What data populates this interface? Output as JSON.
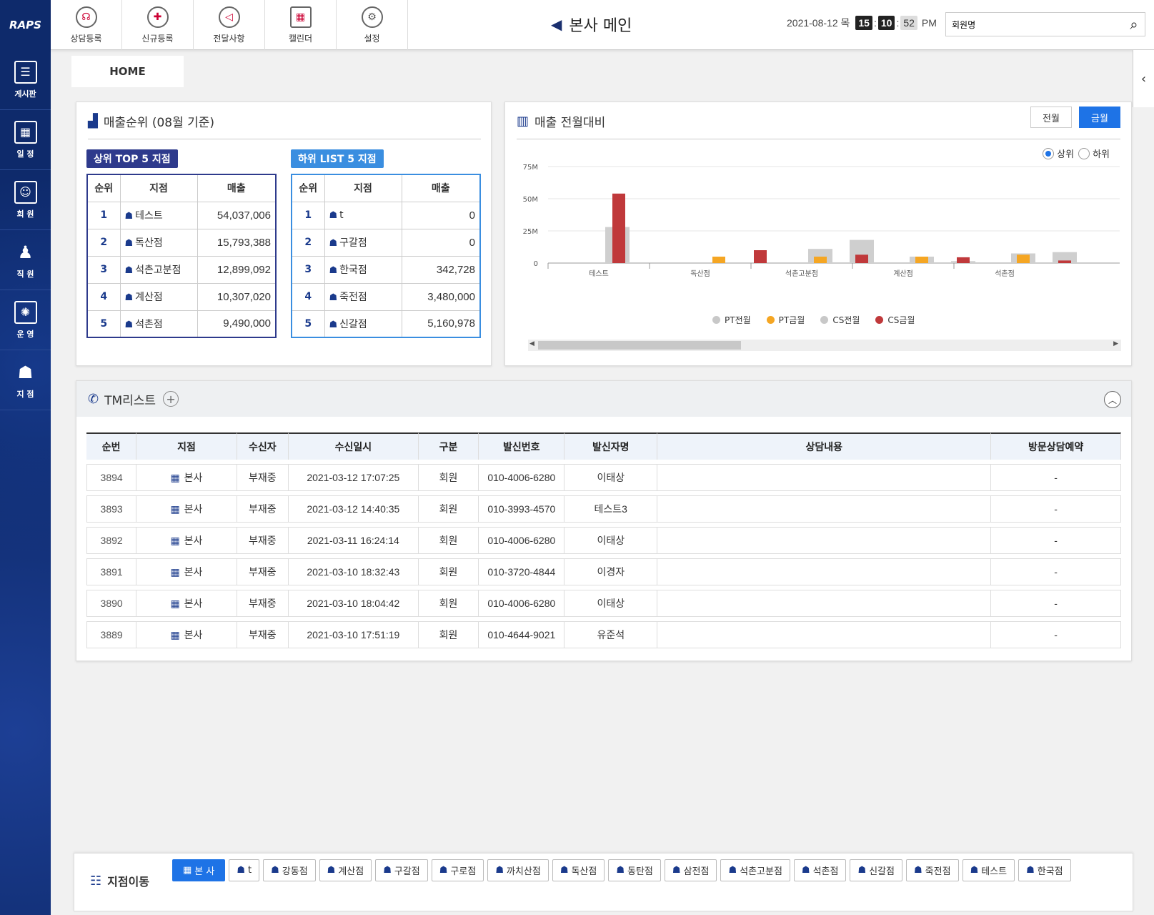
{
  "logo": "RAPS",
  "sidebar": [
    {
      "label": "게시판",
      "icon": "board-icon"
    },
    {
      "label": "일 정",
      "icon": "calendar-icon"
    },
    {
      "label": "회 원",
      "icon": "member-icon"
    },
    {
      "label": "직 원",
      "icon": "staff-icon"
    },
    {
      "label": "운 영",
      "icon": "operation-icon"
    },
    {
      "label": "지 점",
      "icon": "branch-icon"
    }
  ],
  "topmenu": [
    {
      "label": "상담등록",
      "icon": "consult-icon"
    },
    {
      "label": "신규등록",
      "icon": "new-user-icon"
    },
    {
      "label": "전달사항",
      "icon": "megaphone-icon"
    },
    {
      "label": "캘린더",
      "icon": "calendar-icon"
    },
    {
      "label": "설정",
      "icon": "gear-icon"
    }
  ],
  "header": {
    "title": "본사 메인",
    "date": "2021-08-12 목",
    "hour": "15",
    "minute": "10",
    "second": "52",
    "ampm": "PM",
    "search_value": "회원명"
  },
  "home_tab": "HOME",
  "ranking": {
    "title": "매출순위",
    "subtitle": "(08월 기준)",
    "top_label": "상위 TOP 5 지점",
    "low_label": "하위 LIST 5 지점",
    "columns": [
      "순위",
      "지점",
      "매출"
    ],
    "top": [
      {
        "rank": "1",
        "branch": "테스트",
        "amount": "54,037,006"
      },
      {
        "rank": "2",
        "branch": "독산점",
        "amount": "15,793,388"
      },
      {
        "rank": "3",
        "branch": "석촌고분점",
        "amount": "12,899,092"
      },
      {
        "rank": "4",
        "branch": "계산점",
        "amount": "10,307,020"
      },
      {
        "rank": "5",
        "branch": "석촌점",
        "amount": "9,490,000"
      }
    ],
    "low": [
      {
        "rank": "1",
        "branch": "t",
        "amount": "0"
      },
      {
        "rank": "2",
        "branch": "구갈점",
        "amount": "0"
      },
      {
        "rank": "3",
        "branch": "한국점",
        "amount": "342,728"
      },
      {
        "rank": "4",
        "branch": "죽전점",
        "amount": "3,480,000"
      },
      {
        "rank": "5",
        "branch": "신갈점",
        "amount": "5,160,978"
      }
    ]
  },
  "comparison": {
    "title": "매출 전월대비",
    "btn_prev": "전월",
    "btn_cur": "금월",
    "radio_upper": "상위",
    "radio_lower": "하위"
  },
  "chart_data": {
    "type": "bar",
    "categories": [
      "테스트",
      "독산점",
      "석촌고분점",
      "계산점",
      "석촌점"
    ],
    "ylim": [
      0,
      75000000
    ],
    "ytick_labels": [
      "0",
      "25M",
      "50M",
      "75M"
    ],
    "ytick_values": [
      0,
      25000000,
      50000000,
      75000000
    ],
    "series": [
      {
        "name": "PT전월",
        "color": "#c8c8c8",
        "values": [
          0,
          0,
          0,
          0,
          0
        ]
      },
      {
        "name": "PT금월",
        "color": "#f5a623",
        "values": [
          0,
          5000000,
          5000000,
          5000000,
          6500000
        ]
      },
      {
        "name": "CS전월",
        "color": "#cccccc",
        "values": [
          28000000,
          0,
          11000000,
          5000000,
          7500000
        ]
      },
      {
        "name": "CS금월",
        "color": "#c0393b",
        "values": [
          54000000,
          10000000,
          6500000,
          4500000,
          2000000
        ]
      }
    ],
    "series_b": [
      {
        "name": "CS전월",
        "values": [
          0,
          0,
          18000000,
          1500000,
          8500000
        ]
      }
    ]
  },
  "tm": {
    "title": "TM리스트",
    "columns": [
      "순번",
      "지점",
      "수신자",
      "수신일시",
      "구분",
      "발신번호",
      "발신자명",
      "상담내용",
      "방문상담예약"
    ],
    "rows": [
      {
        "no": "3894",
        "branch": "본사",
        "receiver": "부재중",
        "datetime": "2021-03-12 17:07:25",
        "type": "회원",
        "phone": "010-4006-6280",
        "sender": "이태상",
        "content": "",
        "visit": "-"
      },
      {
        "no": "3893",
        "branch": "본사",
        "receiver": "부재중",
        "datetime": "2021-03-12 14:40:35",
        "type": "회원",
        "phone": "010-3993-4570",
        "sender": "테스트3",
        "content": "",
        "visit": "-"
      },
      {
        "no": "3892",
        "branch": "본사",
        "receiver": "부재중",
        "datetime": "2021-03-11 16:24:14",
        "type": "회원",
        "phone": "010-4006-6280",
        "sender": "이태상",
        "content": "",
        "visit": "-"
      },
      {
        "no": "3891",
        "branch": "본사",
        "receiver": "부재중",
        "datetime": "2021-03-10 18:32:43",
        "type": "회원",
        "phone": "010-3720-4844",
        "sender": "이경자",
        "content": "",
        "visit": "-"
      },
      {
        "no": "3890",
        "branch": "본사",
        "receiver": "부재중",
        "datetime": "2021-03-10 18:04:42",
        "type": "회원",
        "phone": "010-4006-6280",
        "sender": "이태상",
        "content": "",
        "visit": "-"
      },
      {
        "no": "3889",
        "branch": "본사",
        "receiver": "부재중",
        "datetime": "2021-03-10 17:51:19",
        "type": "회원",
        "phone": "010-4644-9021",
        "sender": "유준석",
        "content": "",
        "visit": "-"
      }
    ]
  },
  "branch_move": {
    "title": "지점이동",
    "branches": [
      "본 사",
      "t",
      "강동점",
      "계산점",
      "구갈점",
      "구로점",
      "까치산점",
      "독산점",
      "동탄점",
      "삼전점",
      "석촌고분점",
      "석촌점",
      "신갈점",
      "죽전점",
      "테스트",
      "한국점"
    ]
  }
}
